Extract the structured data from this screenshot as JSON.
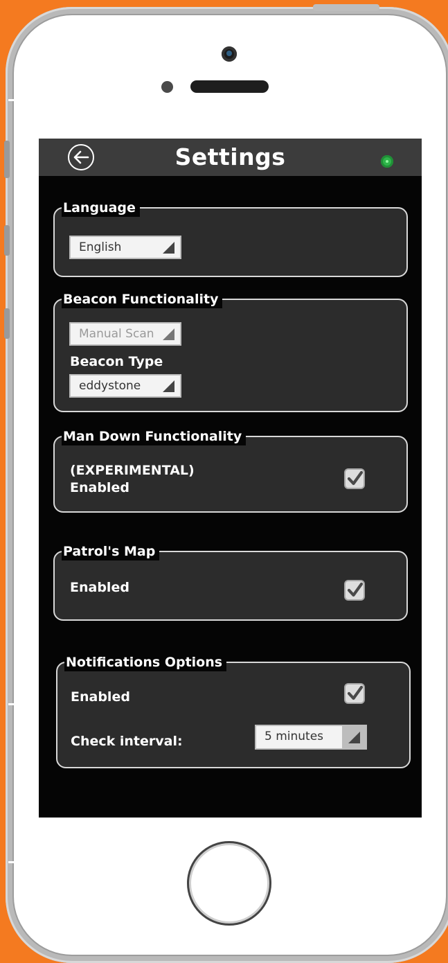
{
  "header": {
    "title": "Settings",
    "status_color": "#2fb44a"
  },
  "language": {
    "legend": "Language",
    "value": "English"
  },
  "beacon": {
    "legend": "Beacon Functionality",
    "scan_mode": "Manual Scan",
    "type_label": "Beacon Type",
    "type_value": "eddystone"
  },
  "man_down": {
    "legend": "Man Down Functionality",
    "label_line1": "(EXPERIMENTAL)",
    "label_line2": "Enabled",
    "checked": true
  },
  "patrol_map": {
    "legend": "Patrol's Map",
    "label": "Enabled",
    "checked": true
  },
  "notifications": {
    "legend": "Notifications Options",
    "enabled_label": "Enabled",
    "checked": true,
    "interval_label": "Check interval:",
    "interval_value": "5 minutes"
  },
  "colors": {
    "background": "#f47a20",
    "screen": "#050505",
    "panel": "#2c2c2c"
  }
}
